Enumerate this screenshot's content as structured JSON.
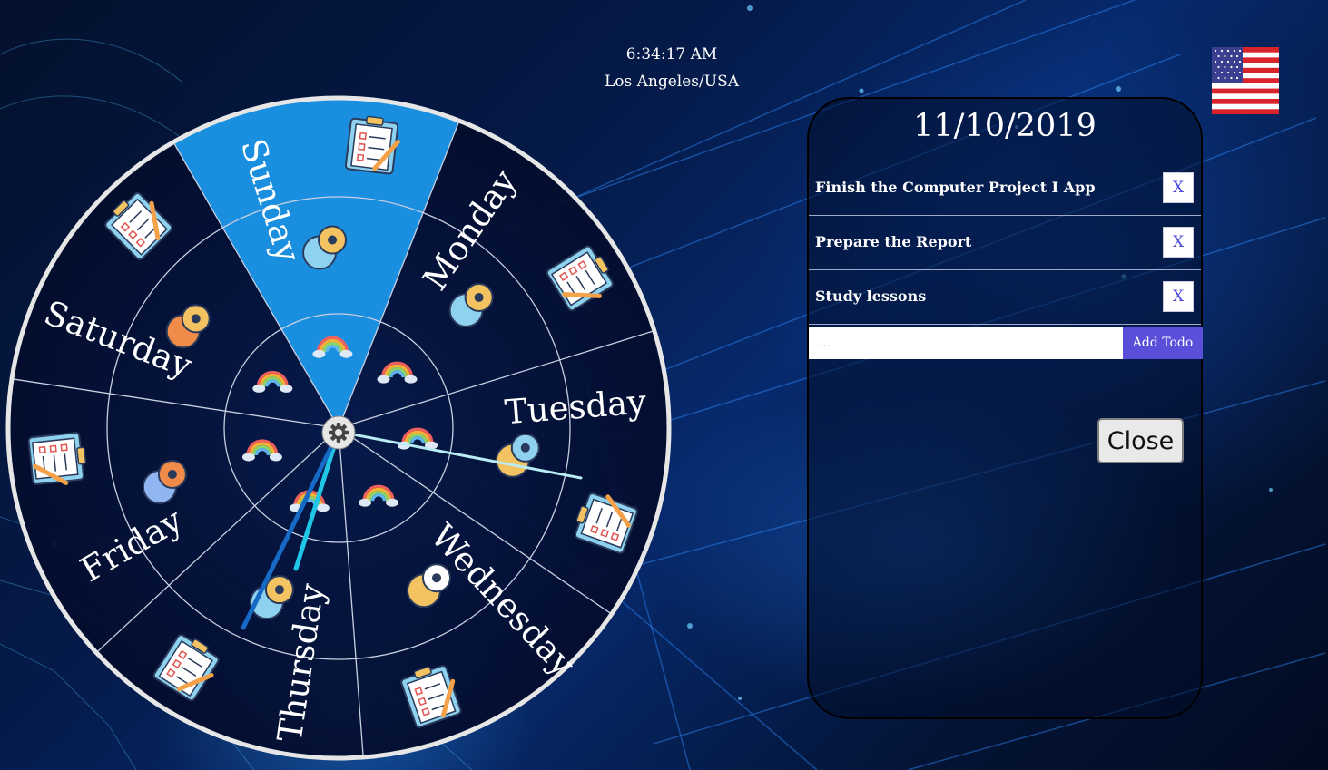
{
  "clock": {
    "time": "6:34:17 AM",
    "city": "Los Angeles/USA"
  },
  "flag": {
    "icon": "us-flag-icon"
  },
  "wheel": {
    "selected_day": "Sunday",
    "days": [
      {
        "label": "Sunday"
      },
      {
        "label": "Monday"
      },
      {
        "label": "Tuesday"
      },
      {
        "label": "Wednesday"
      },
      {
        "label": "Thursday"
      },
      {
        "label": "Friday"
      },
      {
        "label": "Saturday"
      }
    ],
    "center_icon": "gear-icon",
    "colors": {
      "selected": "#1a8fe0",
      "face": "#050f33",
      "rim": "#e6e6e6",
      "lines": "#c8cfe0"
    }
  },
  "panel": {
    "date": "11/10/2019",
    "todos": [
      {
        "text": "Finish the Computer Project I App",
        "remove_label": "X"
      },
      {
        "text": "Prepare the Report",
        "remove_label": "X"
      },
      {
        "text": "Study lessons",
        "remove_label": "X"
      }
    ],
    "input_placeholder": "....",
    "add_label": "Add Todo",
    "close_label": "Close",
    "colors": {
      "add_button": "#5a4fd9",
      "remove_text": "#4a48d6"
    }
  }
}
